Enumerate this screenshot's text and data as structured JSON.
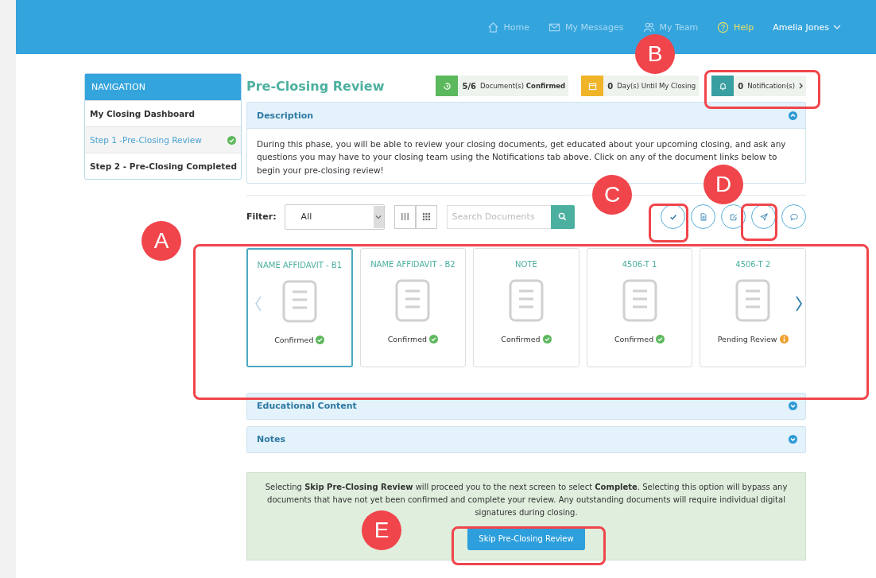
{
  "header": {
    "links": [
      {
        "label": "Home",
        "highlighted": false
      },
      {
        "label": "My Messages",
        "highlighted": false
      },
      {
        "label": "My Team",
        "highlighted": false
      },
      {
        "label": "Help",
        "highlighted": true
      }
    ],
    "user": "Amelia Jones"
  },
  "sidebar": {
    "heading": "NAVIGATION",
    "items": [
      {
        "label": "My Closing Dashboard",
        "selected": false,
        "completed": false
      },
      {
        "label": "Step 1 -Pre-Closing Review",
        "selected": true,
        "completed": true
      },
      {
        "label": "Step 2 - Pre-Closing Completed",
        "selected": false,
        "completed": false
      }
    ]
  },
  "page_title": "Pre-Closing Review",
  "status_badges": [
    {
      "count": "5/6",
      "text": "Document(s) **Confirmed**",
      "color": "#5cb85c",
      "arrow": false
    },
    {
      "count": "0",
      "text": "Day(s) Until My Closing",
      "color": "#f0b429",
      "arrow": false
    },
    {
      "count": "0",
      "text": "Notification(s)",
      "color": "#3a9fa0",
      "arrow": true
    }
  ],
  "description": {
    "title": "Description",
    "expanded": true,
    "text": "During this phase, you will be able to review your closing documents, get educated about your upcoming closing, and ask any questions you may have to your closing team using the Notifications tab above. Click on any of the document links below to begin your pre-closing review!"
  },
  "filter": {
    "label": "Filter:",
    "value": "All",
    "search_placeholder": "Search Documents"
  },
  "documents": [
    {
      "title": "NAME AFFIDAVIT - B1",
      "status": "Confirmed",
      "kind": "confirmed",
      "selected": true
    },
    {
      "title": "NAME AFFIDAVIT - B2",
      "status": "Confirmed",
      "kind": "confirmed",
      "selected": false
    },
    {
      "title": "NOTE",
      "status": "Confirmed",
      "kind": "confirmed",
      "selected": false
    },
    {
      "title": "4506-T 1",
      "status": "Confirmed",
      "kind": "confirmed",
      "selected": false
    },
    {
      "title": "4506-T 2",
      "status": "Pending Review",
      "kind": "pending",
      "selected": false
    }
  ],
  "panels": [
    {
      "title": "Educational Content",
      "expanded": false
    },
    {
      "title": "Notes",
      "expanded": false
    }
  ],
  "skip_notice": {
    "text": "Selecting **Skip Pre-Closing Review** will proceed you to the next screen to select **Complete**. Selecting this option will bypass any documents that have not yet been confirmed and complete your review. Any outstanding documents will require individual digital signatures during closing.",
    "button": "Skip Pre-Closing Review"
  },
  "callouts": [
    "A",
    "B",
    "C",
    "D",
    "E"
  ]
}
